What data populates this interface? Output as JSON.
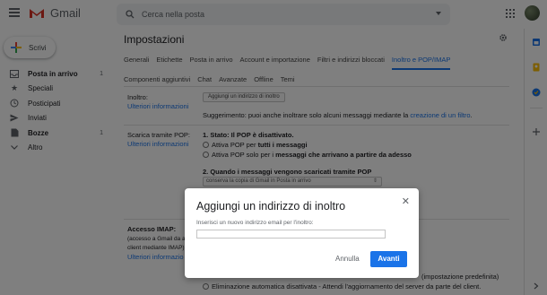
{
  "header": {
    "app_name": "Gmail",
    "search_placeholder": "Cerca nella posta"
  },
  "sidebar": {
    "compose_label": "Scrivi",
    "items": [
      {
        "label": "Posta in arrivo",
        "count": "1",
        "icon": "inbox-icon"
      },
      {
        "label": "Speciali",
        "count": "",
        "icon": "star-icon"
      },
      {
        "label": "Posticipati",
        "count": "",
        "icon": "clock-icon"
      },
      {
        "label": "Inviati",
        "count": "",
        "icon": "send-icon"
      },
      {
        "label": "Bozze",
        "count": "1",
        "icon": "draft-icon"
      },
      {
        "label": "Altro",
        "count": "",
        "icon": "chevron-down-icon"
      }
    ]
  },
  "settings": {
    "title": "Impostazioni",
    "tabs_row1": [
      "Generali",
      "Etichette",
      "Posta in arrivo",
      "Account e importazione",
      "Filtri e indirizzi bloccati",
      "Inoltro e POP/IMAP"
    ],
    "tabs_row2": [
      "Componenti aggiuntivi",
      "Chat",
      "Avanzate",
      "Offline",
      "Temi"
    ],
    "active_tab": "Inoltro e POP/IMAP",
    "forwarding_label": "Inoltro:",
    "learn_more": "Ulteriori informazioni",
    "add_forward_button": "Aggiungi un indirizzo di inoltro",
    "suggestion_text": "Suggerimento: puoi anche inoltrare solo alcuni messaggi mediante la ",
    "suggestion_link": "creazione di un filtro",
    "suggestion_end": ".",
    "pop_label": "Scarica tramite POP:",
    "pop_status": "1. Stato: Il POP è disattivato.",
    "pop_option1_prefix": "Attiva POP per ",
    "pop_option1_bold": "tutti i messaggi",
    "pop_option2_prefix": "Attiva POP solo per i ",
    "pop_option2_bold": "messaggi che arrivano a partire da adesso",
    "pop_step2": "2. Quando i messaggi vengono scaricati tramite POP",
    "pop_select_value": "conserva la copia di Gmail in Posta in arrivo",
    "imap_label": "Accesso IMAP:",
    "imap_sub1": "(accesso a Gmail da altri",
    "imap_sub2": "client mediante IMAP)",
    "imap_learn_more": "Ulteriori informazio",
    "expunge_text_tail": "(impostazione predefinita)",
    "expunge_off": "Eliminazione automatica disattivata - Attendi l'aggiornamento del server da parte del client."
  },
  "dialog": {
    "title": "Aggiungi un indirizzo di inoltro",
    "label": "Inserisci un nuovo indirizzo email per l'inoltro:",
    "input_value": "",
    "cancel_label": "Annulla",
    "ok_label": "Avanti"
  },
  "colors": {
    "accent": "#1a73e8",
    "gmail_red": "#d93025",
    "overlay": "rgba(0,0,0,0.5)"
  }
}
